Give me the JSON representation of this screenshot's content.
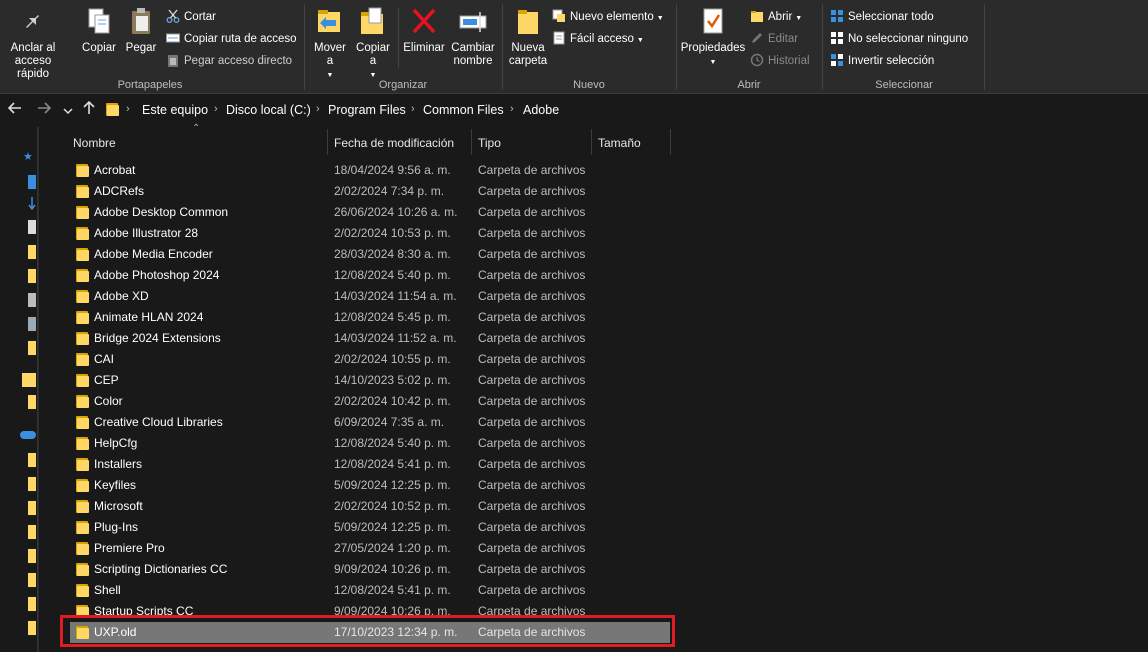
{
  "ribbon": {
    "portapapeles": {
      "label": "Portapapeles",
      "pin": "Anclar al acceso rápido",
      "copy": "Copiar",
      "paste": "Pegar",
      "cut": "Cortar",
      "copy_path": "Copiar ruta de acceso",
      "paste_shortcut": "Pegar acceso directo"
    },
    "organizar": {
      "label": "Organizar",
      "move": "Mover a",
      "copy_to": "Copiar a",
      "delete": "Eliminar",
      "rename": "Cambiar nombre"
    },
    "nuevo": {
      "label": "Nuevo",
      "new_folder": "Nueva carpeta",
      "new_item": "Nuevo elemento",
      "easy_access": "Fácil acceso"
    },
    "abrir": {
      "label": "Abrir",
      "properties": "Propiedades",
      "open": "Abrir",
      "edit": "Editar",
      "history": "Historial"
    },
    "seleccionar": {
      "label": "Seleccionar",
      "select_all": "Seleccionar todo",
      "select_none": "No seleccionar ninguno",
      "invert": "Invertir selección"
    }
  },
  "address": {
    "crumbs": [
      "Este equipo",
      "Disco local (C:)",
      "Program Files",
      "Common Files",
      "Adobe"
    ]
  },
  "columns": {
    "name": "Nombre",
    "date": "Fecha de modificación",
    "type": "Tipo",
    "size": "Tamaño"
  },
  "files": [
    {
      "name": "Acrobat",
      "date": "18/04/2024 9:56 a. m.",
      "type": "Carpeta de archivos"
    },
    {
      "name": "ADCRefs",
      "date": "2/02/2024 7:34 p. m.",
      "type": "Carpeta de archivos"
    },
    {
      "name": "Adobe Desktop Common",
      "date": "26/06/2024 10:26 a. m.",
      "type": "Carpeta de archivos"
    },
    {
      "name": "Adobe Illustrator 28",
      "date": "2/02/2024 10:53 p. m.",
      "type": "Carpeta de archivos"
    },
    {
      "name": "Adobe Media Encoder",
      "date": "28/03/2024 8:30 a. m.",
      "type": "Carpeta de archivos"
    },
    {
      "name": "Adobe Photoshop 2024",
      "date": "12/08/2024 5:40 p. m.",
      "type": "Carpeta de archivos"
    },
    {
      "name": "Adobe XD",
      "date": "14/03/2024 11:54 a. m.",
      "type": "Carpeta de archivos"
    },
    {
      "name": "Animate HLAN 2024",
      "date": "12/08/2024 5:45 p. m.",
      "type": "Carpeta de archivos"
    },
    {
      "name": "Bridge 2024 Extensions",
      "date": "14/03/2024 11:52 a. m.",
      "type": "Carpeta de archivos"
    },
    {
      "name": "CAI",
      "date": "2/02/2024 10:55 p. m.",
      "type": "Carpeta de archivos"
    },
    {
      "name": "CEP",
      "date": "14/10/2023 5:02 p. m.",
      "type": "Carpeta de archivos"
    },
    {
      "name": "Color",
      "date": "2/02/2024 10:42 p. m.",
      "type": "Carpeta de archivos"
    },
    {
      "name": "Creative Cloud Libraries",
      "date": "6/09/2024 7:35 a. m.",
      "type": "Carpeta de archivos"
    },
    {
      "name": "HelpCfg",
      "date": "12/08/2024 5:40 p. m.",
      "type": "Carpeta de archivos"
    },
    {
      "name": "Installers",
      "date": "12/08/2024 5:41 p. m.",
      "type": "Carpeta de archivos"
    },
    {
      "name": "Keyfiles",
      "date": "5/09/2024 12:25 p. m.",
      "type": "Carpeta de archivos"
    },
    {
      "name": "Microsoft",
      "date": "2/02/2024 10:52 p. m.",
      "type": "Carpeta de archivos"
    },
    {
      "name": "Plug-Ins",
      "date": "5/09/2024 12:25 p. m.",
      "type": "Carpeta de archivos"
    },
    {
      "name": "Premiere Pro",
      "date": "27/05/2024 1:20 p. m.",
      "type": "Carpeta de archivos"
    },
    {
      "name": "Scripting Dictionaries CC",
      "date": "9/09/2024 10:26 p. m.",
      "type": "Carpeta de archivos"
    },
    {
      "name": "Shell",
      "date": "12/08/2024 5:41 p. m.",
      "type": "Carpeta de archivos"
    },
    {
      "name": "Startup Scripts CC",
      "date": "9/09/2024 10:26 p. m.",
      "type": "Carpeta de archivos"
    },
    {
      "name": "UXP.old",
      "date": "17/10/2023 12:34 p. m.",
      "type": "Carpeta de archivos",
      "selected": true
    }
  ],
  "colors": {
    "background": "#191919",
    "ribbon": "#2b2b2b",
    "folder": "#ffd766",
    "selection": "#777777",
    "highlight": "#e01b24"
  },
  "icons": [
    "pin-icon",
    "copy-icon",
    "paste-icon",
    "cut-icon",
    "copy-path-icon",
    "paste-shortcut-icon",
    "move-to-icon",
    "copy-to-icon",
    "delete-icon",
    "rename-icon",
    "new-folder-icon",
    "new-item-icon",
    "easy-access-icon",
    "properties-icon",
    "open-icon",
    "edit-icon",
    "history-icon",
    "select-all-icon",
    "select-none-icon",
    "invert-selection-icon",
    "back-arrow-icon",
    "forward-arrow-icon",
    "up-arrow-icon",
    "folder-icon"
  ]
}
